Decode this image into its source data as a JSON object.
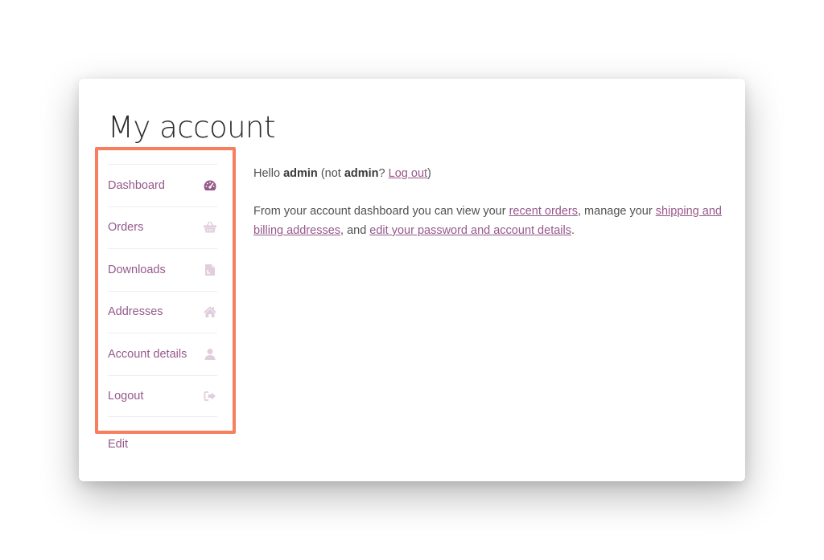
{
  "page": {
    "title": "My account"
  },
  "nav": {
    "items": [
      {
        "label": "Dashboard",
        "icon": "dashboard-gauge-icon",
        "active": true
      },
      {
        "label": "Orders",
        "icon": "basket-icon",
        "active": false
      },
      {
        "label": "Downloads",
        "icon": "file-icon",
        "active": false
      },
      {
        "label": "Addresses",
        "icon": "home-icon",
        "active": false
      },
      {
        "label": "Account details",
        "icon": "user-icon",
        "active": false
      },
      {
        "label": "Logout",
        "icon": "sign-out-icon",
        "active": false
      }
    ],
    "edit_label": "Edit"
  },
  "content": {
    "hello": "Hello",
    "username": "admin",
    "not_open": "(not",
    "username_2": "admin",
    "question": "?",
    "logout_link": "Log out",
    "close_paren": ")",
    "desc_1": "From your account dashboard you can view your",
    "recent_orders_link": "recent orders",
    "desc_2": ", manage your",
    "addresses_link": "shipping and billing addresses",
    "desc_3": ", and",
    "account_link": "edit your password and account details",
    "desc_4": "."
  },
  "colors": {
    "link": "#96588a",
    "icon_active": "#96588a",
    "icon_inactive": "#e2cddd",
    "highlight": "#f77f5e",
    "text": "#515151"
  }
}
